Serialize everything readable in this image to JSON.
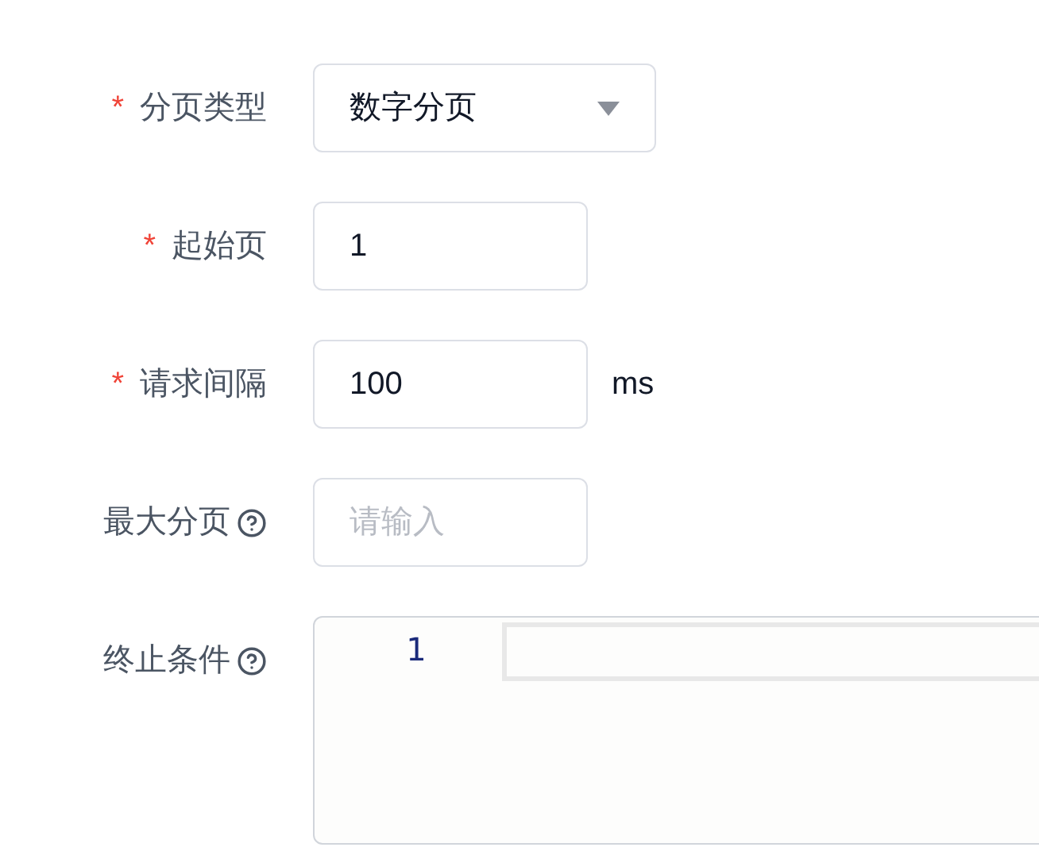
{
  "form": {
    "fields": [
      {
        "kind": "select",
        "label": "分页类型",
        "required_mark": "*",
        "value": "数字分页"
      },
      {
        "kind": "input",
        "label": "起始页",
        "required_mark": "*",
        "value": "1"
      },
      {
        "kind": "input",
        "label": "请求间隔",
        "required_mark": "*",
        "value": "100",
        "suffix": "ms"
      },
      {
        "kind": "input",
        "label": "最大分页",
        "help": true,
        "placeholder": "请输入"
      },
      {
        "kind": "code",
        "label": "终止条件",
        "help": true,
        "line_numbers": [
          "1"
        ]
      }
    ]
  }
}
